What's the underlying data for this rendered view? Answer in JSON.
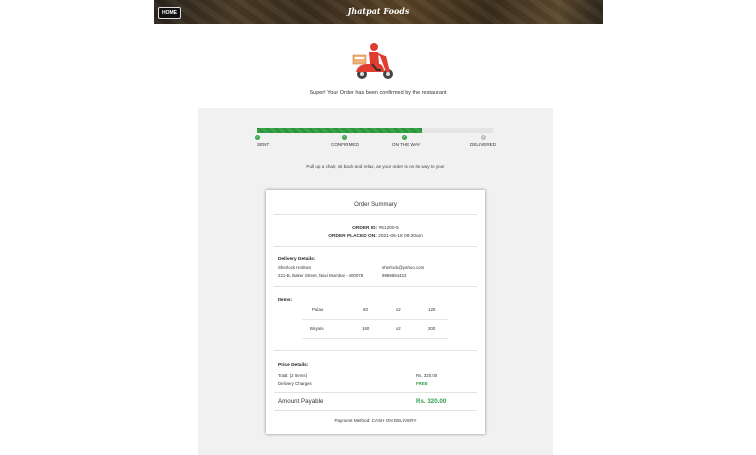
{
  "header": {
    "home_label": "HOME",
    "brand": "Jhatpat Foods"
  },
  "confirmation_message": "Super! Your Order has been confirmed by the restaurant",
  "progress": {
    "fraction": 0.7,
    "steps": [
      {
        "label": "SENT",
        "done": true
      },
      {
        "label": "CONFIRMED",
        "done": true
      },
      {
        "label": "ON THE WAY",
        "done": true
      },
      {
        "label": "DELIVERED",
        "done": false
      }
    ],
    "colors": {
      "done": "#3aa548",
      "pending": "#bdbdbd"
    }
  },
  "relax_message": "Pull up a chair, sit back and relax, as your order is on its way to you!",
  "summary": {
    "title": "Order Summary",
    "order_id_label": "ORDER ID:",
    "order_id": "#51200-5",
    "placed_on_label": "ORDER PLACED ON:",
    "placed_on": "2021-05-18 09:20am",
    "delivery": {
      "heading": "Delivery Details:",
      "name": "Sherlock Holmes",
      "address": "221-B, Baker Street, Navi Mumbai - 400078",
      "email": "sherlock@yahoo.com",
      "phone": "9988554422"
    },
    "items_heading": "Items:",
    "items": [
      {
        "name": "Pulao",
        "price": "60",
        "qty": "x2",
        "total": "120"
      },
      {
        "name": "Biryani",
        "price": "160",
        "qty": "x2",
        "total": "200"
      }
    ],
    "price": {
      "heading": "Price Details:",
      "total_label": "Total: (2 Items)",
      "total_value": "Rs. 320.00",
      "delivery_label": "Delivery Charges",
      "delivery_value": "FREE",
      "payable_label": "Amount Payable",
      "payable_value": "Rs. 320.00"
    },
    "payment_method": "Payment Method: CASH ON DELIVERY"
  }
}
